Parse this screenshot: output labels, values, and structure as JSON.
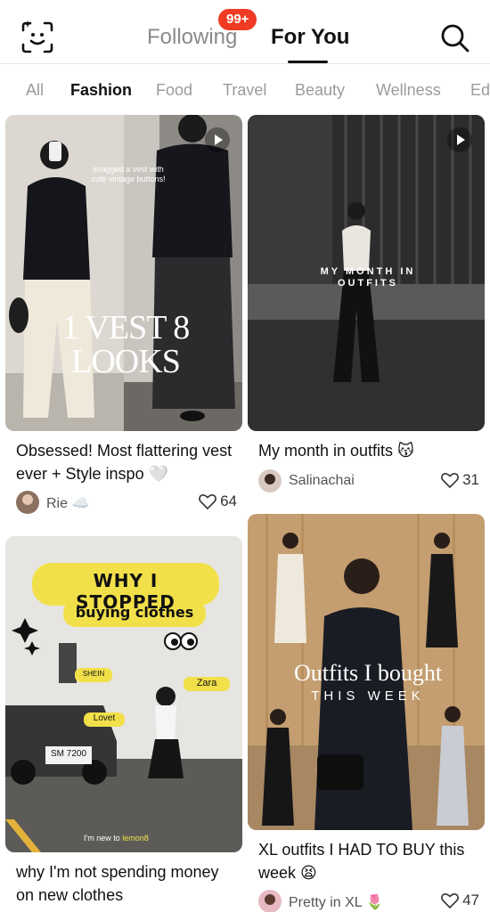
{
  "header": {
    "following_label": "Following",
    "foryou_label": "For You",
    "badge": "99+"
  },
  "categories": [
    "All",
    "Fashion",
    "Food",
    "Travel",
    "Beauty",
    "Wellness",
    "Ed"
  ],
  "active_category": "Fashion",
  "cards": [
    {
      "title": "Obsessed! Most flattering vest ever + Style inspo 🤍",
      "author": "Rie ☁️",
      "likes": "64",
      "overlay_big": "1 VEST 8 LOOKS",
      "overlay_small": "snagged a vest with cute vintage buttons!",
      "video": true
    },
    {
      "title": "My month in outfits 😽",
      "author": "Salinachai",
      "likes": "31",
      "overlay_big": "MY MONTH IN OUTFITS",
      "video": true
    },
    {
      "title": "why I'm not spending money on new clothes",
      "overlay_line1": "WHY I STOPPED",
      "overlay_line2": "buying clothes",
      "tag_shein": "SHEIN",
      "tag_zara": "Zara",
      "tag_lovet": "Lovet",
      "plate": "SM 7200",
      "footnote": "I'm new to",
      "footnote_brand": "lemon8"
    },
    {
      "title": "XL outfits I HAD TO BUY this week 😫",
      "author": "Pretty in XL 🌷",
      "likes": "47",
      "overlay_line1": "Outfits I bought",
      "overlay_line2": "THIS WEEK"
    }
  ],
  "colors": {
    "badge": "#ef3b24",
    "accent": "#111111"
  },
  "icons": [
    "face-scan-icon",
    "search-icon",
    "heart-icon",
    "play-icon"
  ]
}
